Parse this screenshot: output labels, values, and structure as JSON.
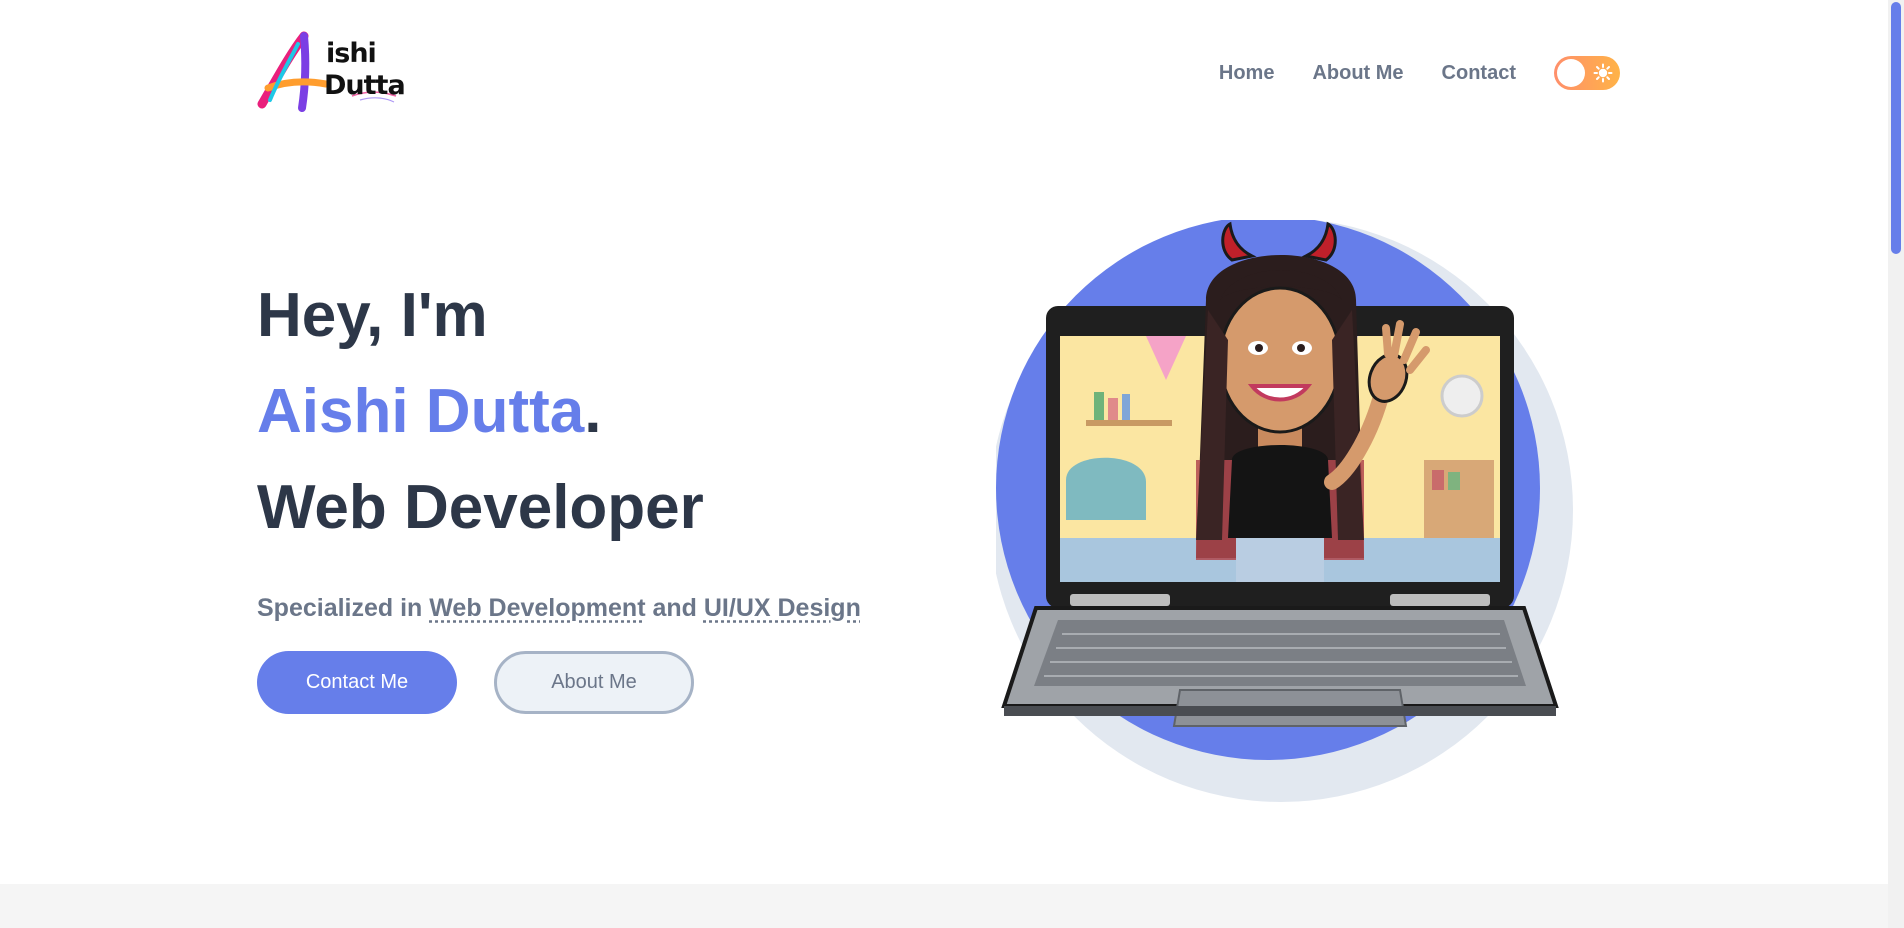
{
  "brand": {
    "logo_text_first": "ishi",
    "logo_text_second": "Dutta",
    "logo_letter": "A"
  },
  "nav": {
    "items": [
      "Home",
      "About Me",
      "Contact"
    ],
    "theme_toggle_icon": "sun-icon"
  },
  "hero": {
    "greeting": "Hey, I'm",
    "name": "Aishi Dutta",
    "name_suffix": ".",
    "role": "Web Developer",
    "subtitle_prefix": "Specialized in ",
    "subtitle_skill_1": "Web Development",
    "subtitle_joiner": " and ",
    "subtitle_skill_2": "UI/UX Design"
  },
  "buttons": {
    "primary": "Contact Me",
    "secondary": "About Me"
  },
  "colors": {
    "accent": "#667eea",
    "heading": "#2d3748",
    "muted": "#6b7689",
    "toggle_start": "#ff8f6b",
    "toggle_end": "#ffb347"
  }
}
